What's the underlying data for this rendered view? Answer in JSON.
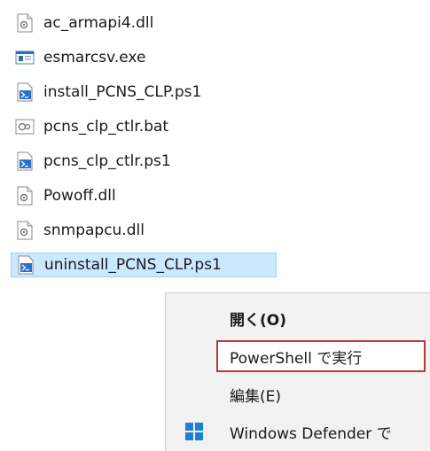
{
  "files": [
    {
      "name": "ac_armapi4.dll",
      "icon": "dll-file-icon"
    },
    {
      "name": "esmarcsv.exe",
      "icon": "exe-file-icon"
    },
    {
      "name": "install_PCNS_CLP.ps1",
      "icon": "powershell-file-icon"
    },
    {
      "name": "pcns_clp_ctlr.bat",
      "icon": "bat-file-icon"
    },
    {
      "name": "pcns_clp_ctlr.ps1",
      "icon": "powershell-file-icon"
    },
    {
      "name": "Powoff.dll",
      "icon": "dll-file-icon"
    },
    {
      "name": "snmpapcu.dll",
      "icon": "dll-file-icon"
    },
    {
      "name": "uninstall_PCNS_CLP.ps1",
      "icon": "powershell-file-icon",
      "selected": true
    }
  ],
  "context_menu": {
    "open_label": "開く(O)",
    "run_powershell_label": "PowerShell で実行",
    "edit_label": "編集(E)",
    "defender_label": "Windows Defender で",
    "highlight_color": "#b53a3a"
  },
  "colors": {
    "selection_bg": "#cce8ff",
    "selection_border": "#99d1ff",
    "menu_bg": "#f2f2f2"
  }
}
